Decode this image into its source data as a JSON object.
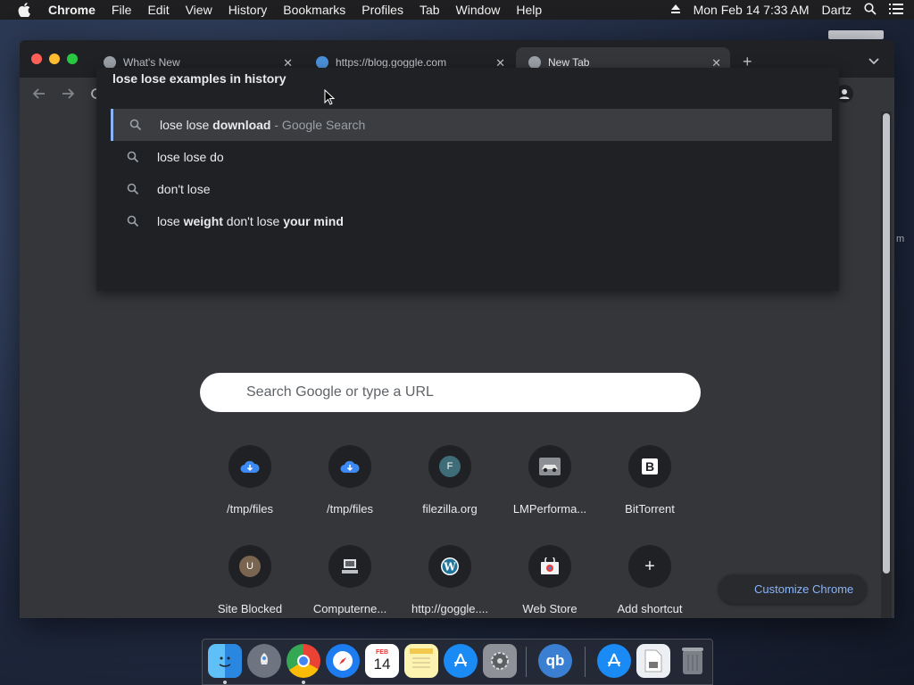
{
  "menubar": {
    "app_name": "Chrome",
    "items": [
      "File",
      "Edit",
      "View",
      "History",
      "Bookmarks",
      "Profiles",
      "Tab",
      "Window",
      "Help"
    ],
    "datetime": "Mon Feb 14  7:33 AM",
    "user": "Dartz"
  },
  "tabs": [
    {
      "title": "What's New",
      "icon": "chrome-icon"
    },
    {
      "title": "https://blog.goggle.com",
      "icon": "wordpress-icon"
    },
    {
      "title": "New Tab",
      "icon": "chrome-icon",
      "active": true
    }
  ],
  "omnibox": {
    "input_text": "lose lose examples in history",
    "suggestions": [
      {
        "plain": "lose lose ",
        "bold": "download",
        "suffix": " - Google Search",
        "selected": true
      },
      {
        "plain": "lose lose do",
        "bold": "",
        "suffix": ""
      },
      {
        "plain": "don't lose",
        "bold": "",
        "suffix": ""
      },
      {
        "plain": "lose ",
        "bold": "weight",
        "rest_plain": " don't lose ",
        "rest_bold": "your mind",
        "suffix": ""
      }
    ]
  },
  "ntp": {
    "search_placeholder": "Search Google or type a URL",
    "shortcuts": [
      {
        "label": "/tmp/files",
        "icon": "cloud-icon"
      },
      {
        "label": "/tmp/files",
        "icon": "cloud-icon"
      },
      {
        "label": "filezilla.org",
        "icon": "letter-f-icon",
        "letter": "F"
      },
      {
        "label": "LMPerforma...",
        "icon": "car-thumbnail-icon"
      },
      {
        "label": "BitTorrent",
        "icon": "bittorrent-b-icon",
        "letter": "B"
      },
      {
        "label": "Site Blocked",
        "icon": "letter-u-icon",
        "letter": "U"
      },
      {
        "label": "Computerne...",
        "icon": "computer-icon"
      },
      {
        "label": "http://goggle....",
        "icon": "wordpress-icon"
      },
      {
        "label": "Web Store",
        "icon": "web-store-icon"
      },
      {
        "label": "Add shortcut",
        "icon": "plus-icon",
        "letter": "+"
      }
    ],
    "customize_label": "Customize Chrome"
  },
  "dock": {
    "apps": [
      "Finder",
      "Launchpad",
      "Chrome",
      "Safari",
      "Calendar",
      "Notes",
      "App Store",
      "System Preferences",
      "qBittorrent",
      "Applications",
      "Documents",
      "Trash"
    ],
    "calendar_month": "FEB",
    "calendar_day": "14",
    "qbittorrent_text": "qb"
  },
  "colors": {
    "accent": "#8ab4f8",
    "window_bg": "#35363a",
    "dropdown_bg": "#202124"
  }
}
